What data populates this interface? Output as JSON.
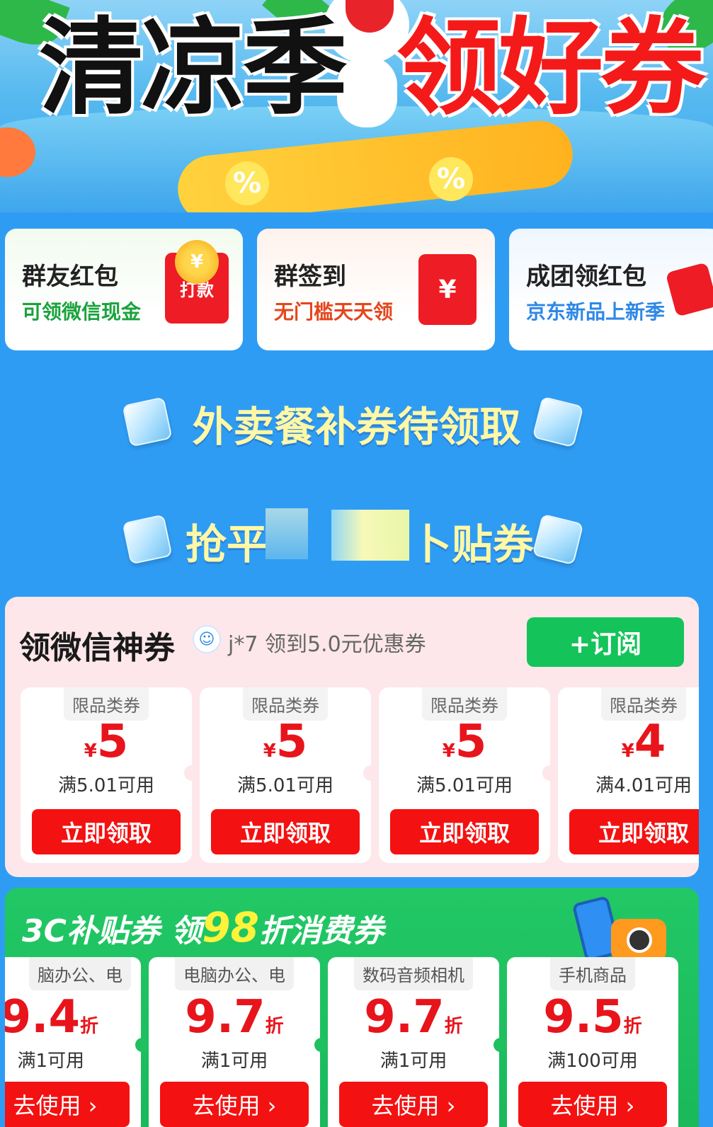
{
  "banner": {
    "title_black": "清凉季",
    "title_red": "领好券",
    "percent_symbol": "%"
  },
  "promo_cards": [
    {
      "title": "群友红包",
      "subtitle": "可领微信现金",
      "subtitle_color": "#1aa33c",
      "badge": "打款"
    },
    {
      "title": "群签到",
      "subtitle": "无门槛天天领",
      "subtitle_color": "#e5461c",
      "badge": "¥"
    },
    {
      "title": "成团领红包",
      "subtitle": "京东新品上新季",
      "subtitle_color": "#2f88e6",
      "badge": ""
    }
  ],
  "sections": {
    "takeout": "外卖餐补券待领取",
    "subsidy_left": "抢平",
    "subsidy_right": "卜贴券"
  },
  "wechat": {
    "title": "领微信神券",
    "ticker": "j*7  领到5.0元优惠券",
    "subscribe_label": "+订阅",
    "coupons": [
      {
        "tag": "限品类券",
        "yen": "¥",
        "amount": "5",
        "condition": "满5.01可用",
        "button": "立即领取"
      },
      {
        "tag": "限品类券",
        "yen": "¥",
        "amount": "5",
        "condition": "满5.01可用",
        "button": "立即领取"
      },
      {
        "tag": "限品类券",
        "yen": "¥",
        "amount": "5",
        "condition": "满5.01可用",
        "button": "立即领取"
      },
      {
        "tag": "限品类券",
        "yen": "¥",
        "amount": "4",
        "condition": "满4.01可用",
        "button": "立即领取"
      }
    ]
  },
  "c3": {
    "title_prefix": "3C补贴券 领",
    "title_highlight": "98",
    "title_suffix": "折消费券",
    "coupons": [
      {
        "tag": "脑办公、电",
        "discount": "9.4",
        "unit": "折",
        "condition": "满1可用",
        "button": "去使用 ›"
      },
      {
        "tag": "电脑办公、电",
        "discount": "9.7",
        "unit": "折",
        "condition": "满1可用",
        "button": "去使用 ›"
      },
      {
        "tag": "数码音频相机",
        "discount": "9.7",
        "unit": "折",
        "condition": "满1可用",
        "button": "去使用 ›"
      },
      {
        "tag": "手机商品",
        "discount": "9.5",
        "unit": "折",
        "condition": "满100可用",
        "button": "去使用 ›"
      }
    ]
  },
  "colors": {
    "page_bg": "#2f9cf4",
    "accent_red": "#f41111",
    "subscribe_green": "#14c35a",
    "section_yellow": "#fff8a6"
  }
}
